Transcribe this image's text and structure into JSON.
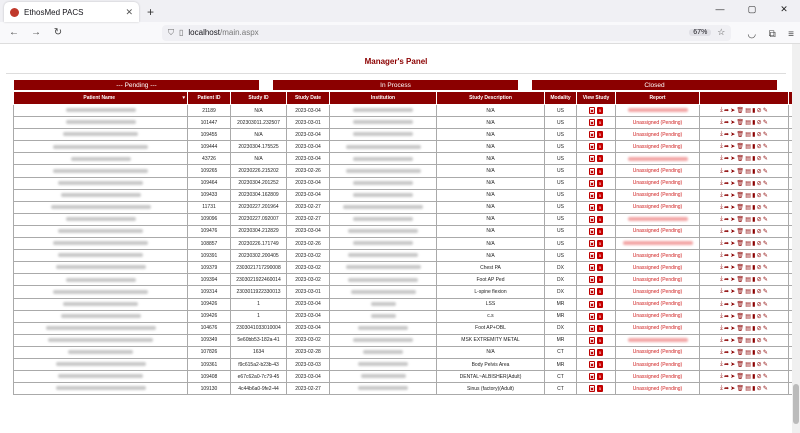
{
  "browser": {
    "tab_title": "EthosMed PACS",
    "new_tab": "+",
    "url_host": "localhost",
    "url_path": "/main.aspx",
    "zoom": "67%",
    "window_controls": [
      "—",
      "▢",
      "✕"
    ]
  },
  "panel": {
    "title": "Manager's Panel",
    "status_tabs": {
      "pending": "--- Pending ---",
      "in_process": "In Process",
      "closed": "Closed"
    }
  },
  "table": {
    "headers": [
      "Patient Name",
      "Patient ID",
      "Study ID",
      "Study Date",
      "Institution",
      "Study Description",
      "Modality",
      "View Study",
      "Report",
      "",
      "Stable"
    ],
    "sort_indicator": "▾",
    "rows": [
      {
        "pid": "21189",
        "sid": "N/A",
        "date": "2023-03-04",
        "desc": "N/A",
        "mod": "US",
        "report": "",
        "pending": false
      },
      {
        "pid": "101447",
        "sid": "202303011.232507",
        "date": "2023-03-01",
        "desc": "N/A",
        "mod": "US",
        "report": "Unassigned (Pending)",
        "pending": true
      },
      {
        "pid": "109455",
        "sid": "N/A",
        "date": "2023-03-04",
        "desc": "N/A",
        "mod": "US",
        "report": "Unassigned (Pending)",
        "pending": true
      },
      {
        "pid": "109444",
        "sid": "20230304.175525",
        "date": "2023-03-04",
        "desc": "N/A",
        "mod": "US",
        "report": "Unassigned (Pending)",
        "pending": true
      },
      {
        "pid": "43726",
        "sid": "N/A",
        "date": "2023-03-04",
        "desc": "N/A",
        "mod": "US",
        "report": "",
        "pending": false
      },
      {
        "pid": "109265",
        "sid": "20230226.215202",
        "date": "2023-02-26",
        "desc": "N/A",
        "mod": "US",
        "report": "Unassigned (Pending)",
        "pending": true
      },
      {
        "pid": "109464",
        "sid": "20230304.201252",
        "date": "2023-03-04",
        "desc": "N/A",
        "mod": "US",
        "report": "Unassigned (Pending)",
        "pending": true
      },
      {
        "pid": "109433",
        "sid": "20230304.162809",
        "date": "2023-03-04",
        "desc": "N/A",
        "mod": "US",
        "report": "Unassigned (Pending)",
        "pending": true
      },
      {
        "pid": "11731",
        "sid": "20230227.201964",
        "date": "2023-02-27",
        "desc": "N/A",
        "mod": "US",
        "report": "Unassigned (Pending)",
        "pending": true
      },
      {
        "pid": "109096",
        "sid": "20230227.092007",
        "date": "2023-02-27",
        "desc": "N/A",
        "mod": "US",
        "report": "",
        "pending": false
      },
      {
        "pid": "109476",
        "sid": "20230304.212829",
        "date": "2023-03-04",
        "desc": "N/A",
        "mod": "US",
        "report": "Unassigned (Pending)",
        "pending": true
      },
      {
        "pid": "108857",
        "sid": "20230226.171749",
        "date": "2023-02-26",
        "desc": "N/A",
        "mod": "US",
        "report": "",
        "pending": false
      },
      {
        "pid": "109391",
        "sid": "20230302.200405",
        "date": "2023-03-02",
        "desc": "N/A",
        "mod": "US",
        "report": "Unassigned (Pending)",
        "pending": true
      },
      {
        "pid": "109379",
        "sid": "2303021717290008",
        "date": "2023-03-02",
        "desc": "Chest PA",
        "mod": "DX",
        "report": "Unassigned (Pending)",
        "pending": true
      },
      {
        "pid": "109394",
        "sid": "2303021922460014",
        "date": "2023-03-02",
        "desc": "Foot AP Ped",
        "mod": "DX",
        "report": "Unassigned (Pending)",
        "pending": true
      },
      {
        "pid": "109314",
        "sid": "2303011922330013",
        "date": "2023-03-01",
        "desc": "L-spine flexion",
        "mod": "DX",
        "report": "Unassigned (Pending)",
        "pending": true
      },
      {
        "pid": "109426",
        "sid": "1",
        "date": "2023-03-04",
        "desc": "LSS",
        "mod": "MR",
        "report": "Unassigned (Pending)",
        "pending": true
      },
      {
        "pid": "109426",
        "sid": "1",
        "date": "2023-03-04",
        "desc": "c.s",
        "mod": "MR",
        "report": "Unassigned (Pending)",
        "pending": true
      },
      {
        "pid": "104676",
        "sid": "2303041033010004",
        "date": "2023-03-04",
        "desc": "Foot AP+OBL",
        "mod": "DX",
        "report": "Unassigned (Pending)",
        "pending": true
      },
      {
        "pid": "109349",
        "sid": "5e60bb53-182a-41",
        "date": "2023-03-02",
        "desc": "MSK EXTREMITY METAL",
        "mod": "MR",
        "report": "",
        "pending": false
      },
      {
        "pid": "107826",
        "sid": "1634",
        "date": "2023-02-28",
        "desc": "N/A",
        "mod": "CT",
        "report": "Unassigned (Pending)",
        "pending": true
      },
      {
        "pid": "109361",
        "sid": "f9c615a2-b23b-43",
        "date": "2023-03-03",
        "desc": "Body Pelvis Area",
        "mod": "MR",
        "report": "Unassigned (Pending)",
        "pending": true
      },
      {
        "pid": "109408",
        "sid": "e67c62a0-7c79-45",
        "date": "2023-03-04",
        "desc": "DENTAL~ALBISHER(Adult)",
        "mod": "CT",
        "report": "Unassigned (Pending)",
        "pending": true
      },
      {
        "pid": "109130",
        "sid": "4c44b6a0-9fe2-44",
        "date": "2023-02-27",
        "desc": "Sinus (factory)(Adult)",
        "mod": "CT",
        "report": "Unassigned (Pending)",
        "pending": true
      }
    ]
  },
  "icons": {
    "view": [
      "dicom-viewer-icon",
      "html5-viewer-icon"
    ],
    "actions": [
      "download-icon",
      "share-icon",
      "forward-icon",
      "delete-icon",
      "report-icon",
      "chart-icon",
      "attach-icon",
      "edit-icon"
    ],
    "stable": "check-icon"
  }
}
